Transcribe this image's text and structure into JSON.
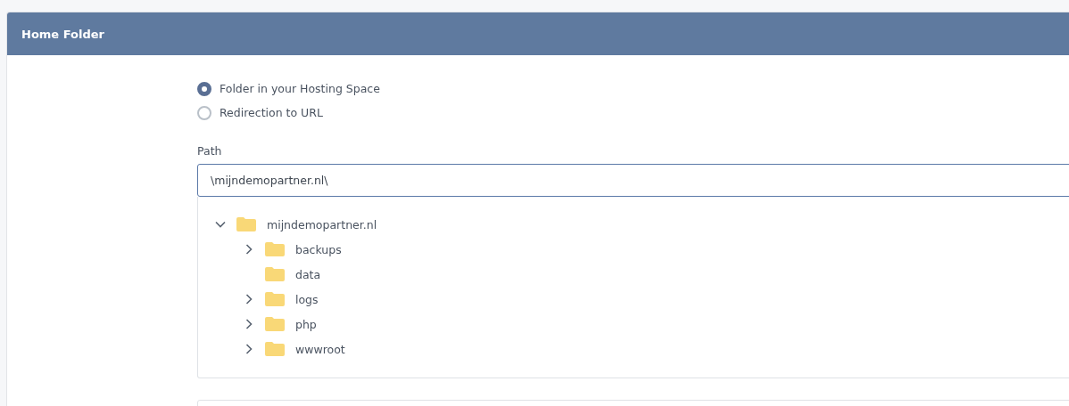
{
  "panel": {
    "title": "Home Folder"
  },
  "options": [
    {
      "label": "Folder in your Hosting Space",
      "selected": true
    },
    {
      "label": "Redirection to URL",
      "selected": false
    }
  ],
  "path": {
    "label": "Path",
    "value": "\\mijndemopartner.nl\\"
  },
  "tree": [
    {
      "name": "mijndemopartner.nl",
      "expanded": true,
      "children": [
        {
          "name": "backups",
          "expanded": false
        },
        {
          "name": "data"
        },
        {
          "name": "logs",
          "expanded": false
        },
        {
          "name": "php",
          "expanded": false
        },
        {
          "name": "wwwroot",
          "expanded": false
        }
      ]
    }
  ]
}
